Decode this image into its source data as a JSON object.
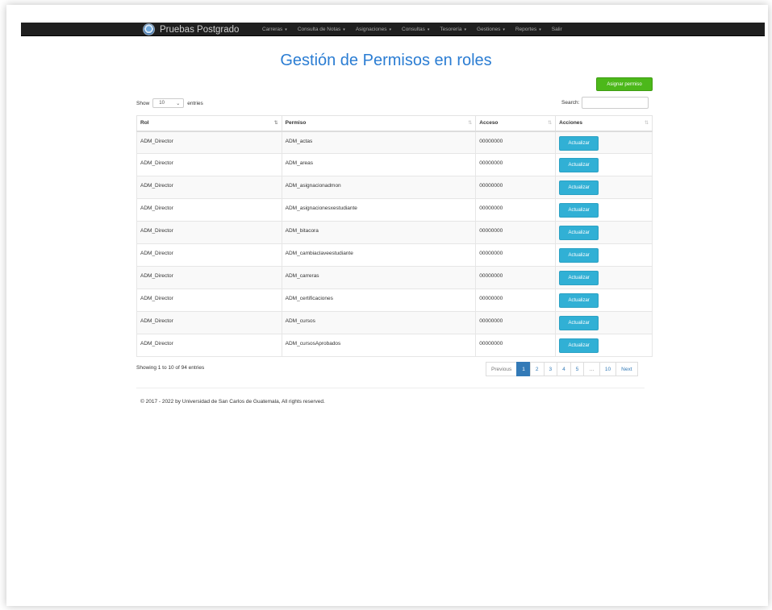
{
  "navbar": {
    "brand": "Pruebas Postgrado",
    "items": [
      {
        "label": "Carreras",
        "dropdown": true
      },
      {
        "label": "Consulta de Notas",
        "dropdown": true
      },
      {
        "label": "Asignaciones",
        "dropdown": true
      },
      {
        "label": "Consultas",
        "dropdown": true
      },
      {
        "label": "Tesorería",
        "dropdown": true
      },
      {
        "label": "Gestiones",
        "dropdown": true
      },
      {
        "label": "Reportes",
        "dropdown": true
      },
      {
        "label": "Salir",
        "dropdown": false
      }
    ]
  },
  "page": {
    "title": "Gestión de Permisos en roles",
    "assign_button": "Asignar permiso"
  },
  "length": {
    "prefix": "Show",
    "value": "10",
    "suffix": "entries"
  },
  "search": {
    "label": "Search:",
    "value": ""
  },
  "table": {
    "columns": [
      "Rol",
      "Permiso",
      "Acceso",
      "Acciones"
    ],
    "rows": [
      {
        "rol": "ADM_Director",
        "permiso": "ADM_actas",
        "acceso": "00000000",
        "action": "Actualizar"
      },
      {
        "rol": "ADM_Director",
        "permiso": "ADM_areas",
        "acceso": "00000000",
        "action": "Actualizar"
      },
      {
        "rol": "ADM_Director",
        "permiso": "ADM_asignacionadmon",
        "acceso": "00000000",
        "action": "Actualizar"
      },
      {
        "rol": "ADM_Director",
        "permiso": "ADM_asignacionesxestudiante",
        "acceso": "00000000",
        "action": "Actualizar"
      },
      {
        "rol": "ADM_Director",
        "permiso": "ADM_bitacora",
        "acceso": "00000000",
        "action": "Actualizar"
      },
      {
        "rol": "ADM_Director",
        "permiso": "ADM_cambiaclaveestudiante",
        "acceso": "00000000",
        "action": "Actualizar"
      },
      {
        "rol": "ADM_Director",
        "permiso": "ADM_carreras",
        "acceso": "00000000",
        "action": "Actualizar"
      },
      {
        "rol": "ADM_Director",
        "permiso": "ADM_certificaciones",
        "acceso": "00000000",
        "action": "Actualizar"
      },
      {
        "rol": "ADM_Director",
        "permiso": "ADM_cursos",
        "acceso": "00000000",
        "action": "Actualizar"
      },
      {
        "rol": "ADM_Director",
        "permiso": "ADM_cursosAprobados",
        "acceso": "00000000",
        "action": "Actualizar"
      }
    ]
  },
  "info": "Showing 1 to 10 of 94 entries",
  "pagination": {
    "previous": "Previous",
    "pages": [
      "1",
      "2",
      "3",
      "4",
      "5",
      "…",
      "10"
    ],
    "active": "1",
    "next": "Next"
  },
  "footer": "© 2017 - 2022 by Universidad de San Carlos de Guatemala, All rights reserved.",
  "colors": {
    "navbar": "#1f1f1f",
    "title": "#2b7dd3",
    "assign_button": "#4cb81a",
    "update_button": "#31b0d5",
    "pagination_active": "#337ab7"
  }
}
